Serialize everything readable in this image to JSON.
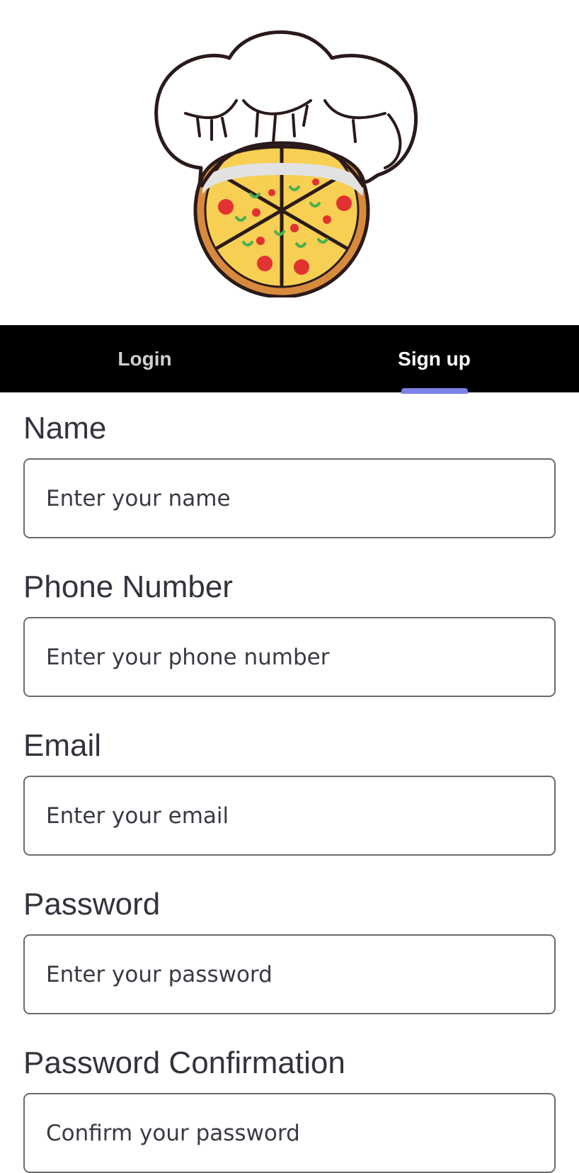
{
  "logo": {
    "icon": "chef-hat-pizza-icon",
    "colors": {
      "outline": "#2a1a1a",
      "hat": "#ffffff",
      "hat_shadow": "#e2e2e2",
      "crust": "#d88a3c",
      "cheese": "#f7cf52",
      "pepperoni": "#e23232",
      "pepper": "#4caf50"
    }
  },
  "tabs": {
    "login_label": "Login",
    "signup_label": "Sign up",
    "active": "Sign up",
    "indicator_color": "#7b83e6"
  },
  "form": {
    "name": {
      "label": "Name",
      "placeholder": "Enter your name",
      "value": ""
    },
    "phone": {
      "label": "Phone Number",
      "placeholder": "Enter your phone number",
      "value": ""
    },
    "email": {
      "label": "Email",
      "placeholder": "Enter your email",
      "value": ""
    },
    "password": {
      "label": "Password",
      "placeholder": "Enter your password",
      "value": ""
    },
    "password_confirmation": {
      "label": "Password Confirmation",
      "placeholder": "Confirm your password",
      "value": ""
    }
  }
}
